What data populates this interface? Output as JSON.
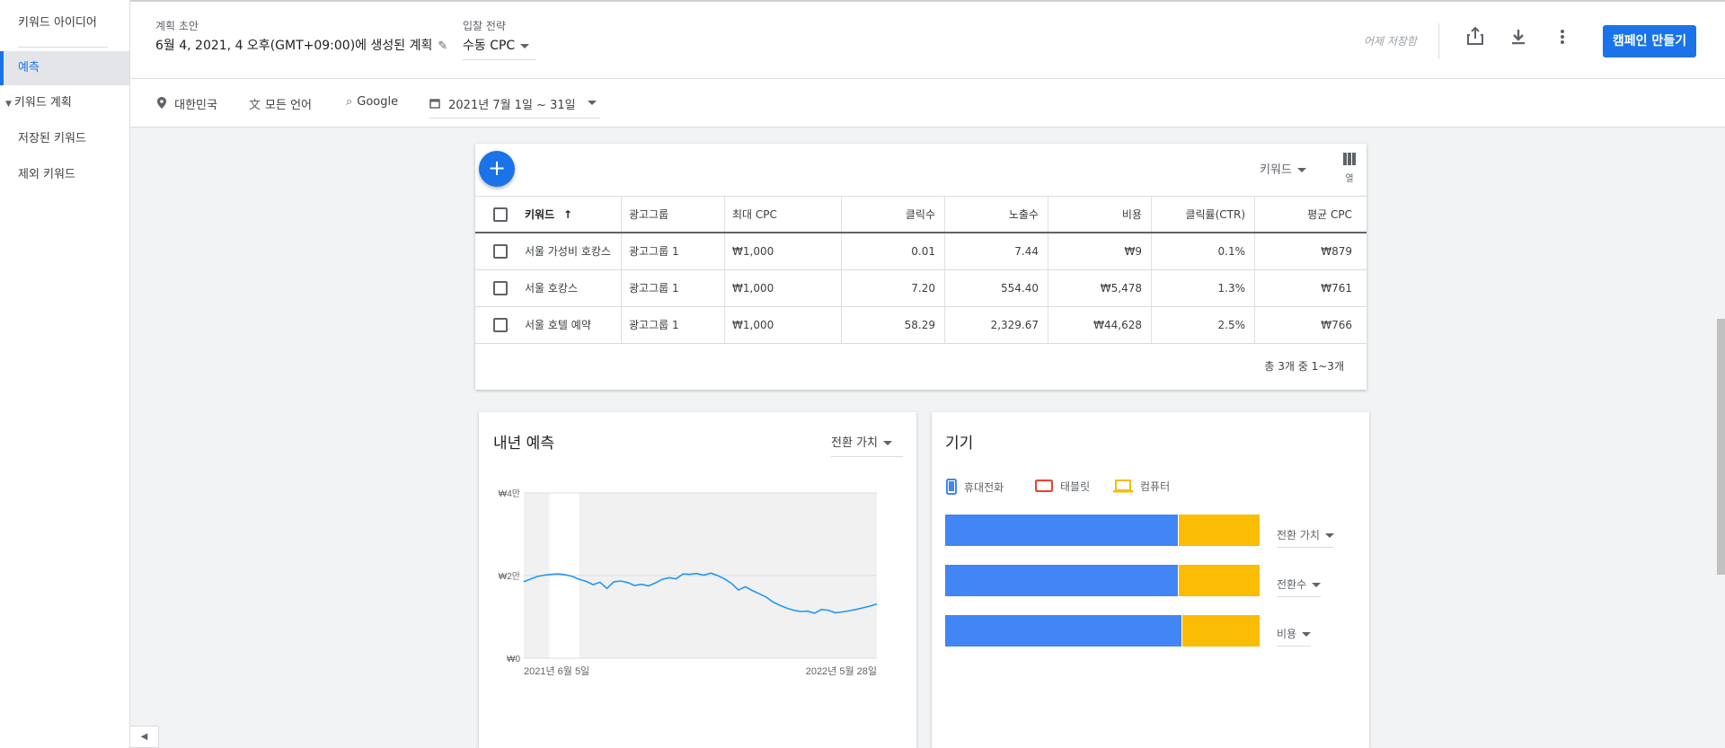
{
  "sidebar": {
    "items": [
      {
        "label": "키워드 아이디어"
      },
      {
        "label": "예측"
      },
      {
        "label": "키워드 계획"
      },
      {
        "label": "저장된 키워드"
      },
      {
        "label": "제외 키워드"
      }
    ]
  },
  "header": {
    "plan_label": "계획 초안",
    "plan_value": "6월 4, 2021, 4 오후(GMT+09:00)에 생성된 계획",
    "bid_label": "입찰 전략",
    "bid_value": "수동 CPC",
    "saved_text": "어제 저장함",
    "create_button": "캠페인 만들기"
  },
  "filters": {
    "location": "대한민국",
    "language": "모든 언어",
    "network": "Google",
    "date_range": "2021년 7월 1일 ~ 31일"
  },
  "table": {
    "keyword_dropdown": "키워드",
    "columns_label": "열",
    "headers": [
      "키워드",
      "광고그룹",
      "최대 CPC",
      "클릭수",
      "노출수",
      "비용",
      "클릭률(CTR)",
      "평균 CPC"
    ],
    "sort_arrow": "↑",
    "rows": [
      [
        "서울 가성비 호캉스",
        "광고그룹 1",
        "₩1,000",
        "0.01",
        "7.44",
        "₩9",
        "0.1%",
        "₩879"
      ],
      [
        "서울 호캉스",
        "광고그룹 1",
        "₩1,000",
        "7.20",
        "554.40",
        "₩5,478",
        "1.3%",
        "₩761"
      ],
      [
        "서울 호텔 예약",
        "광고그룹 1",
        "₩1,000",
        "58.29",
        "2,329.67",
        "₩44,628",
        "2.5%",
        "₩766"
      ]
    ],
    "pagination": "총 3개 중 1~3개"
  },
  "forecast": {
    "title": "내년 예측",
    "metric": "전환 가치"
  },
  "devices": {
    "title": "기기",
    "legend": [
      {
        "name": "휴대전화",
        "color": "#4285f4",
        "icon": "mobile-icon"
      },
      {
        "name": "태블릿",
        "color": "#ea4335",
        "icon": "tablet-icon"
      },
      {
        "name": "컴퓨터",
        "color": "#fbbc04",
        "icon": "laptop-icon"
      }
    ],
    "rows": [
      {
        "metric": "전환 가치",
        "mobile_share": 0.74,
        "tablet_share": 0.0,
        "computer_share": 0.26
      },
      {
        "metric": "전환수",
        "mobile_share": 0.74,
        "tablet_share": 0.0,
        "computer_share": 0.26
      },
      {
        "metric": "비용",
        "mobile_share": 0.75,
        "tablet_share": 0.0,
        "computer_share": 0.25
      }
    ]
  },
  "chart_data": {
    "type": "line",
    "title": "",
    "xlabel": "",
    "ylabel": "",
    "y_tick_labels": [
      "₩4만",
      "₩2만",
      "₩0"
    ],
    "y_ticks": [
      40000,
      20000,
      0
    ],
    "ylim": [
      0,
      40000
    ],
    "x_tick_labels": [
      "2021년 6월 5일",
      "2022년 5월 28일"
    ],
    "x": [
      "2021-06-05",
      "2021-06-12",
      "2021-06-19",
      "2021-06-26",
      "2021-07-03",
      "2021-07-10",
      "2021-07-17",
      "2021-07-24",
      "2021-07-31",
      "2021-08-07",
      "2021-08-14",
      "2021-08-21",
      "2021-08-28",
      "2021-09-04",
      "2021-09-11",
      "2021-09-18",
      "2021-09-25",
      "2021-10-02",
      "2021-10-09",
      "2021-10-16",
      "2021-10-23",
      "2021-10-30",
      "2021-11-06",
      "2021-11-13",
      "2021-11-20",
      "2021-11-27",
      "2021-12-04",
      "2021-12-11",
      "2021-12-18",
      "2021-12-25",
      "2022-01-01",
      "2022-01-08",
      "2022-01-15",
      "2022-01-22",
      "2022-01-29",
      "2022-02-05",
      "2022-02-12",
      "2022-02-19",
      "2022-02-26",
      "2022-03-05",
      "2022-03-12",
      "2022-03-19",
      "2022-03-26",
      "2022-04-02",
      "2022-04-09",
      "2022-04-16",
      "2022-04-23",
      "2022-04-30",
      "2022-05-07",
      "2022-05-14",
      "2022-05-21",
      "2022-05-28"
    ],
    "series": [
      {
        "values": [
          18500,
          19200,
          19800,
          20100,
          20300,
          20400,
          20200,
          19800,
          19100,
          18600,
          17800,
          18400,
          16900,
          18500,
          18700,
          18300,
          17600,
          17900,
          17500,
          18200,
          19100,
          19500,
          19200,
          20400,
          20300,
          20500,
          20100,
          20600,
          20000,
          19200,
          18100,
          16500,
          17300,
          16400,
          15600,
          14800,
          13600,
          12800,
          12100,
          11600,
          11300,
          11400,
          10900,
          11800,
          11600,
          11000,
          11200,
          11500,
          11800,
          12200,
          12600,
          13100
        ]
      }
    ],
    "highlight_range": [
      "2021-07-01",
      "2021-07-31"
    ],
    "grid": true
  },
  "colors": {
    "accent": "#1a73e8",
    "line": "#2196f3",
    "mobile": "#4285f4",
    "computer": "#fbbc04",
    "tablet": "#ea4335"
  }
}
